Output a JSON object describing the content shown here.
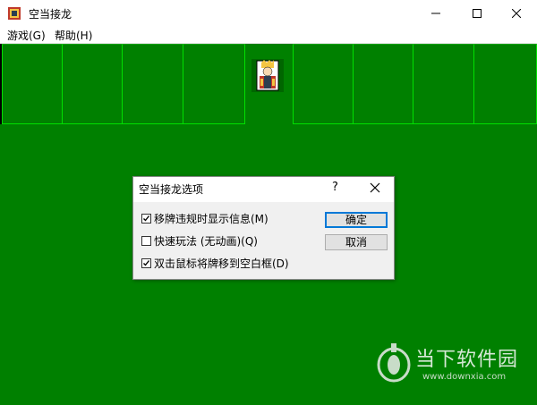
{
  "window": {
    "title": "空当接龙"
  },
  "menu": {
    "game": "游戏(G)",
    "help": "帮助(H)"
  },
  "dialog": {
    "title": "空当接龙选项",
    "help_glyph": "?",
    "options": [
      {
        "label": "移牌违规时显示信息(M)",
        "checked": true
      },
      {
        "label": "快速玩法 (无动画)(Q)",
        "checked": false
      },
      {
        "label": "双击鼠标将牌移到空白框(D)",
        "checked": true
      }
    ],
    "ok_label": "确定",
    "cancel_label": "取消"
  },
  "watermark": {
    "text": "当下软件园",
    "url": "www.downxia.com"
  },
  "colors": {
    "felt": "#008000",
    "slot_border": "#00e000",
    "accent": "#0078d7"
  },
  "icons": {
    "app": "king-card-icon",
    "minimize": "minimize-icon",
    "maximize": "maximize-icon",
    "close": "close-icon",
    "king": "king-face-icon"
  }
}
